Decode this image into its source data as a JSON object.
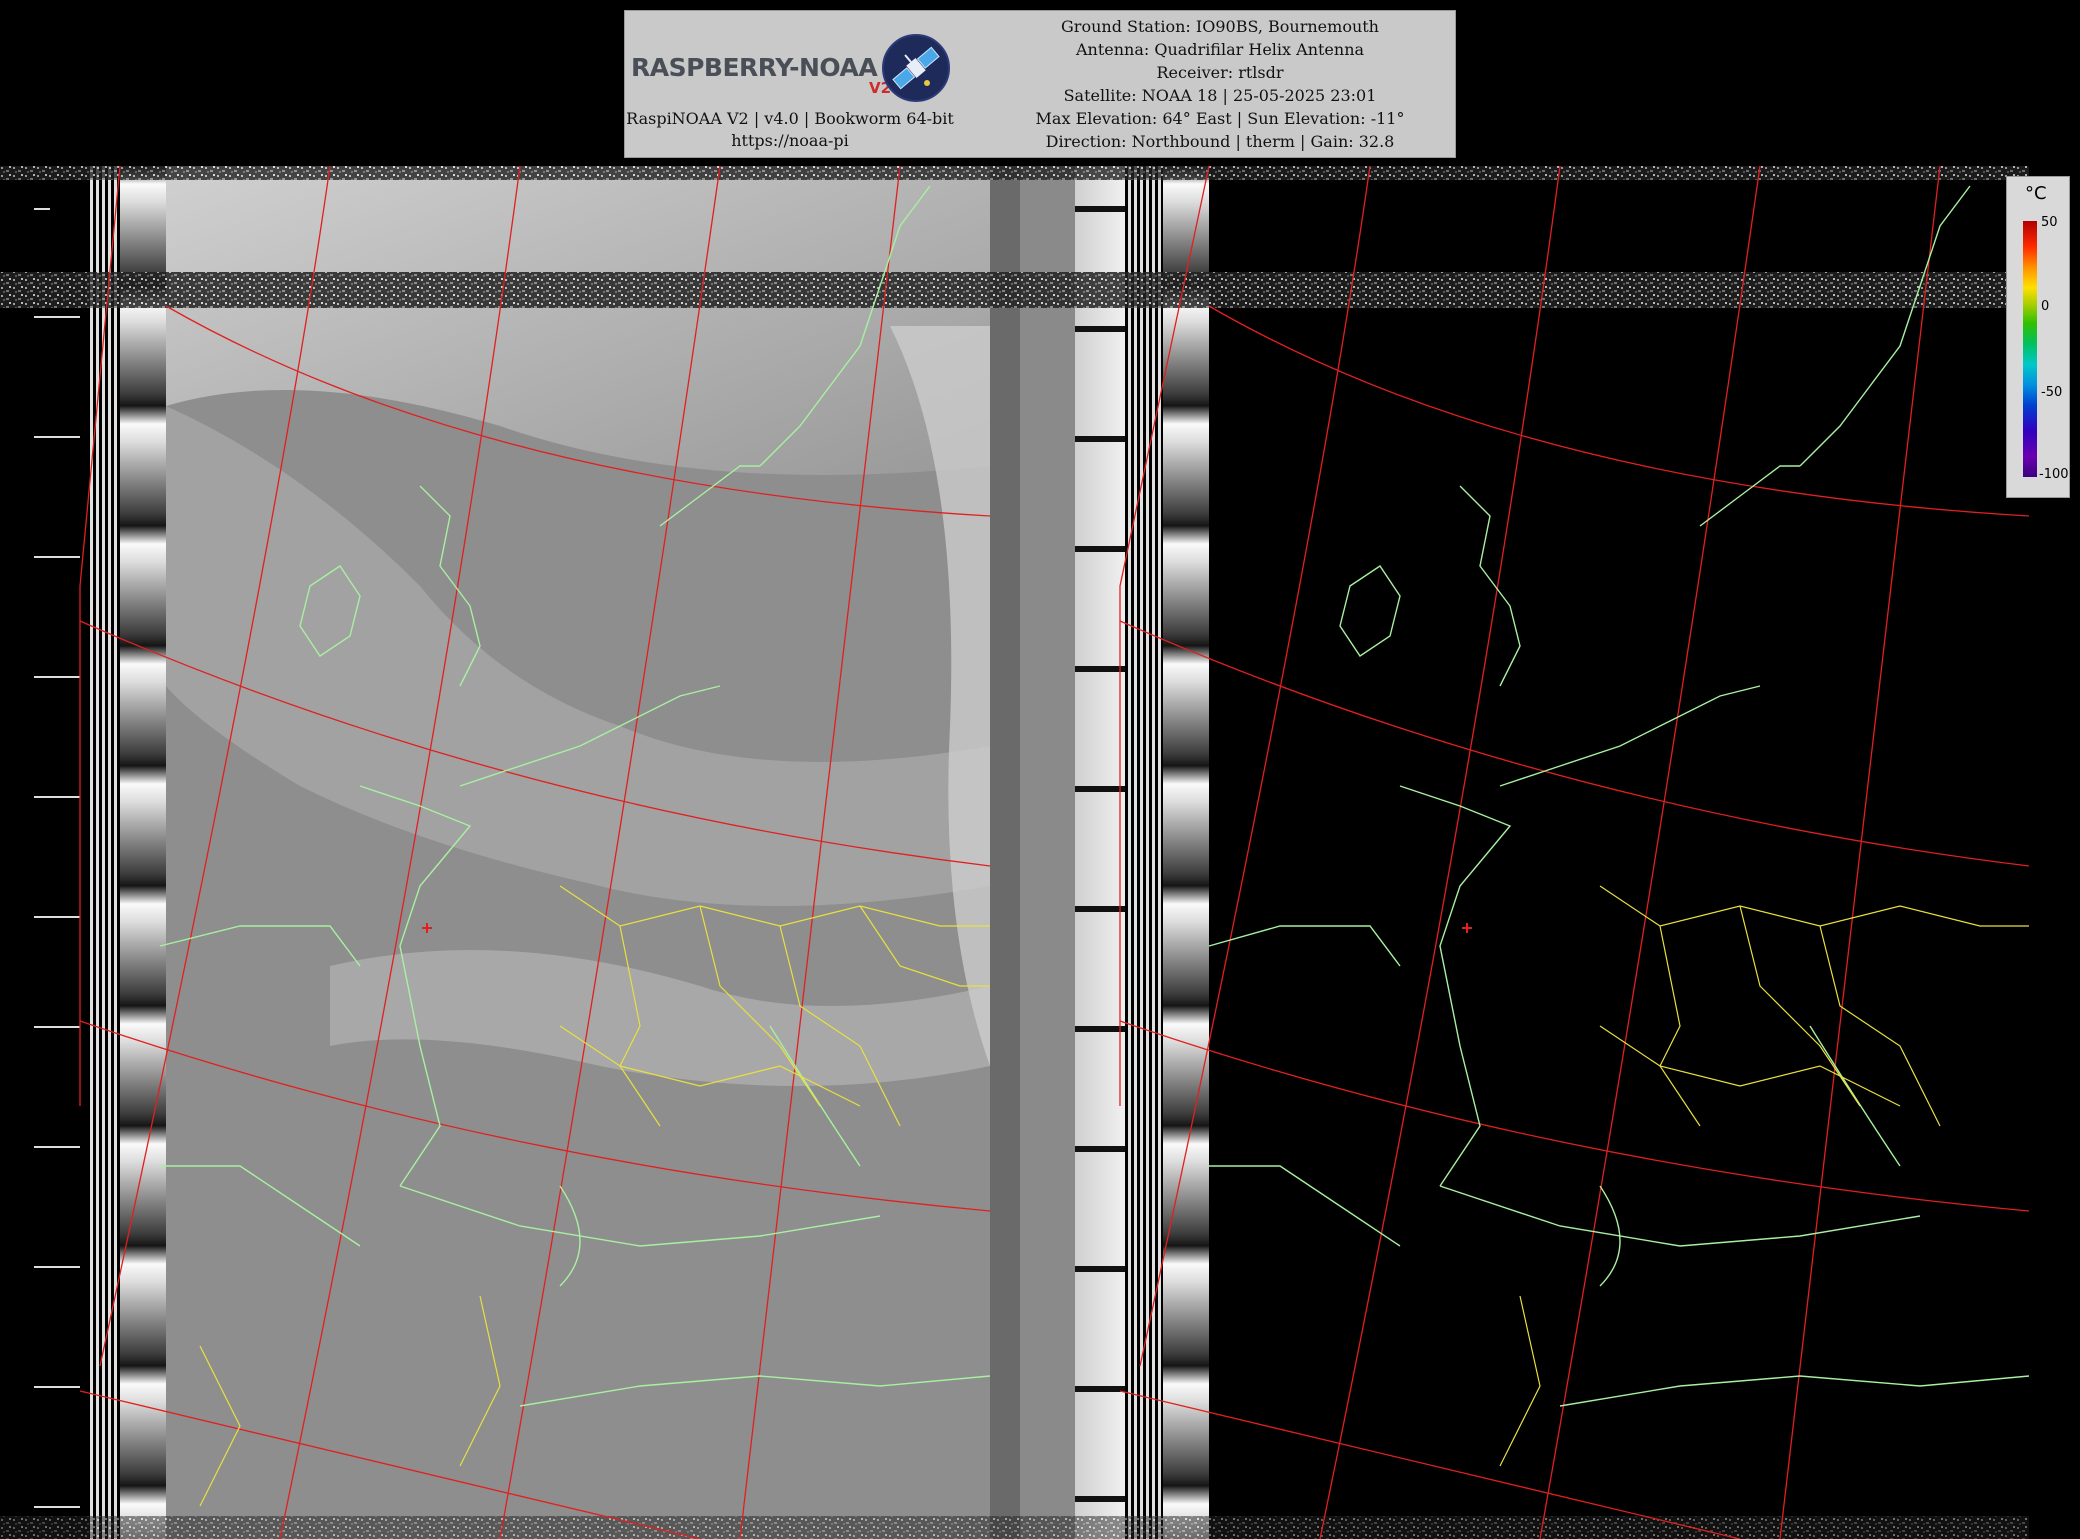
{
  "header": {
    "logo_text": "RASPBERRY-NOAA",
    "logo_version": "V2",
    "software_line": "RaspiNOAA V2 | v4.0 | Bookworm 64-bit",
    "url_line": "https://noaa-pi",
    "ground_station": "Ground Station: IO90BS, Bournemouth",
    "antenna": "Antenna: Quadrifilar Helix Antenna",
    "receiver": "Receiver: rtlsdr",
    "satellite": "Satellite: NOAA 18 | 25-05-2025 23:01",
    "elevation": "Max Elevation: 64° East | Sun Elevation: -11°",
    "direction": "Direction: Northbound | therm | Gain: 32.8"
  },
  "temperature_scale": {
    "unit": "°C",
    "ticks": [
      "50",
      "0",
      "-50",
      "-100"
    ]
  },
  "colors": {
    "graticule": "#e02020",
    "coastline": "#a8f0a0",
    "border": "#e8e040",
    "banner_bg": "#c9c9c9",
    "left_image_bg": "#8e8e8e",
    "right_image_bg": "#000000"
  },
  "icons": {
    "logo_badge": "satellite-icon",
    "station_marker": "cross-marker-icon"
  }
}
